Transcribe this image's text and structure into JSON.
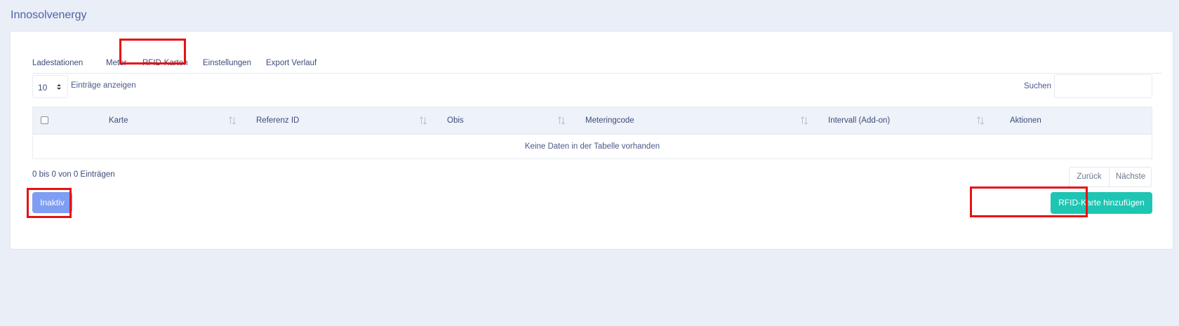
{
  "app": {
    "title": "Innosolvenergy"
  },
  "tabs": [
    {
      "label": "Ladestationen",
      "active": false
    },
    {
      "label": "Meter",
      "active": false
    },
    {
      "label": "RFID-Karten",
      "active": true
    },
    {
      "label": "Einstellungen",
      "active": false
    },
    {
      "label": "Export Verlauf",
      "active": false
    }
  ],
  "table_controls": {
    "length_value": "10",
    "length_label": "Einträge anzeigen",
    "search_label": "Suchen",
    "search_value": ""
  },
  "table": {
    "columns": [
      "Karte",
      "Referenz ID",
      "Obis",
      "Meteringcode",
      "Intervall (Add-on)",
      "Aktionen"
    ],
    "empty_message": "Keine Daten in der Tabelle vorhanden"
  },
  "footer": {
    "info": "0 bis 0 von 0 Einträgen",
    "prev_label": "Zurück",
    "next_label": "Nächste"
  },
  "actions": {
    "inaktiv_label": "Inaktiv",
    "add_label": "RFID-Karte hinzufügen"
  },
  "colors": {
    "background": "#e9eef7",
    "inaktiv_button": "#7f9df2",
    "add_button": "#1ec5b3",
    "highlight": "#e81010"
  }
}
